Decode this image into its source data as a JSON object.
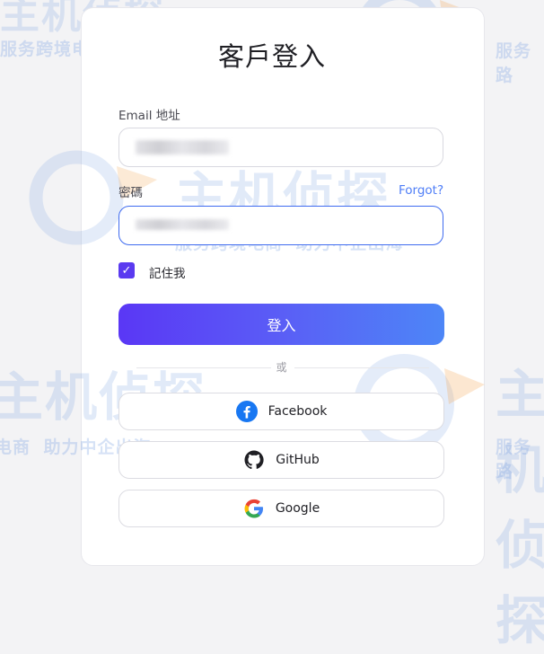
{
  "title": "客戶登入",
  "email": {
    "label": "Email 地址",
    "value": ""
  },
  "password": {
    "label": "密碼",
    "forgot": "Forgot?",
    "value": ""
  },
  "remember": {
    "label": "記住我",
    "checked": true
  },
  "login_button": "登入",
  "divider": "或",
  "social": [
    {
      "name": "Facebook",
      "icon": "facebook-icon"
    },
    {
      "name": "GitHub",
      "icon": "github-icon"
    },
    {
      "name": "Google",
      "icon": "google-icon"
    }
  ],
  "colors": {
    "accent": "#5a37f5",
    "accent_end": "#4d86f7",
    "link": "#4f7ef7",
    "focus_border": "#3f6bf0"
  },
  "watermark": {
    "brand_top": "主机侦探",
    "slogan_1": "服务跨境电商",
    "slogan_2": "助力中企出海",
    "tagline_short_1": "服务跨",
    "tagline_short_2": "电商",
    "tagline_short_3": "服务路"
  }
}
